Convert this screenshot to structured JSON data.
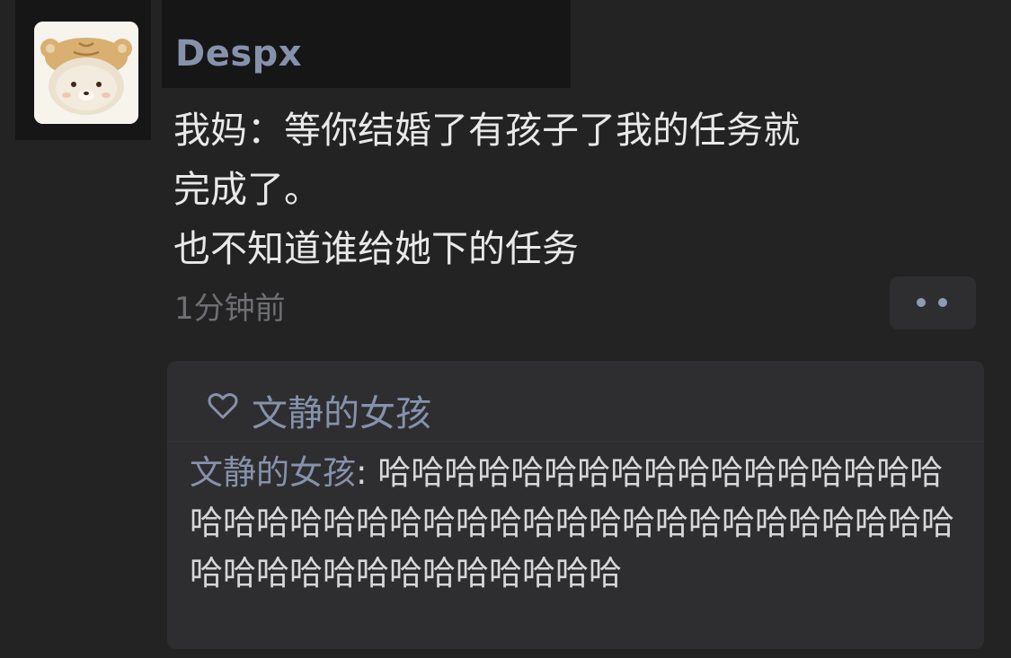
{
  "post": {
    "author": "Despx",
    "text_lines": [
      "我妈：等你结婚了有孩子了我的任务就",
      "完成了。",
      "也不知道谁给她下的任务"
    ],
    "timestamp": "1分钟前",
    "more_icon": "ellipsis-icon"
  },
  "likes": {
    "icon": "heart-outline-icon",
    "names": "文静的女孩"
  },
  "comments": [
    {
      "author": "文静的女孩",
      "separator": ": ",
      "text": "哈哈哈哈哈哈哈哈哈哈哈哈哈哈哈哈哈哈哈哈哈哈哈哈哈哈哈哈哈哈哈哈哈哈哈哈哈哈哈哈哈哈哈哈哈哈哈哈哈哈哈哈哈"
    }
  ],
  "colors": {
    "background": "#232324",
    "name_blue": "#8692ac",
    "text": "#e9e9ea",
    "muted": "#6e6f73",
    "comment_bg": "#2e2e30"
  }
}
